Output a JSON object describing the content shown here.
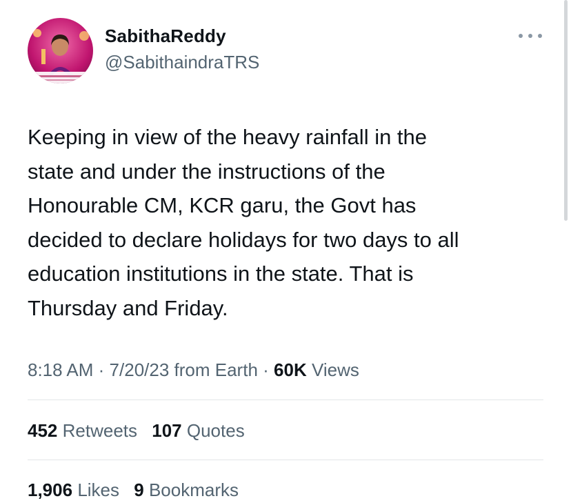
{
  "author": {
    "display_name": "SabithaReddy",
    "handle": "@SabithaindraTRS",
    "avatar_icon": "profile-photo"
  },
  "more_icon": "ellipsis-icon",
  "tweet": {
    "text": "Keeping in view of the heavy rainfall in the\nstate and under the instructions of the\nHonourable CM, KCR garu, the Govt has\ndecided to declare holidays for two days to all\neducation institutions in the state. That is\nThursday and Friday."
  },
  "meta": {
    "time": "8:18 AM",
    "separator": "·",
    "date": "7/20/23",
    "source": "from Earth",
    "views_count": "60K",
    "views_label": "Views"
  },
  "stats": {
    "retweets_count": "452",
    "retweets_label": "Retweets",
    "quotes_count": "107",
    "quotes_label": "Quotes",
    "likes_count": "1,906",
    "likes_label": "Likes",
    "bookmarks_count": "9",
    "bookmarks_label": "Bookmarks"
  },
  "colors": {
    "text_primary": "#0f1419",
    "text_secondary": "#536471",
    "divider": "#e3e6e8",
    "avatar_background": "#c0156f"
  }
}
